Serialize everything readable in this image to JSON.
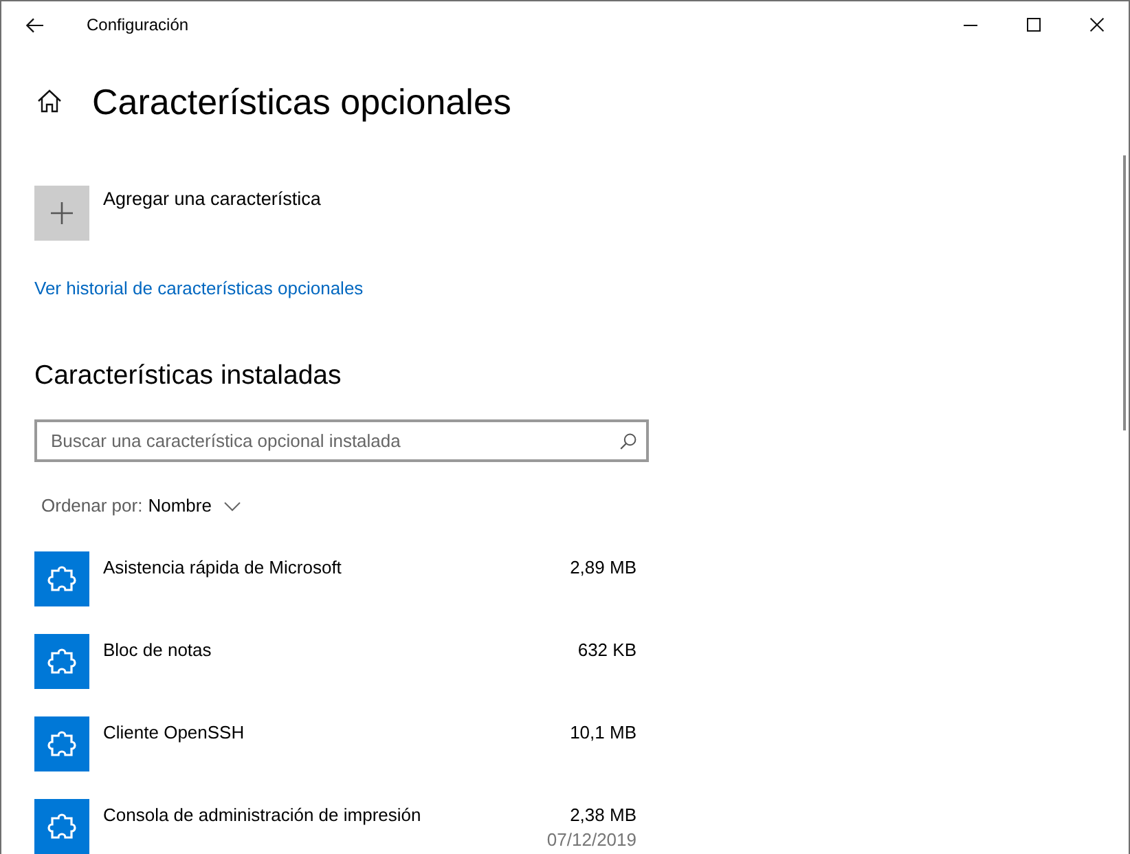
{
  "window": {
    "title": "Configuración"
  },
  "page": {
    "title": "Características opcionales"
  },
  "add_feature": {
    "label": "Agregar una característica"
  },
  "history_link": {
    "label": "Ver historial de características opcionales"
  },
  "installed": {
    "heading": "Características instaladas",
    "search": {
      "placeholder": "Buscar una característica opcional instalada"
    },
    "sort": {
      "label": "Ordenar por:",
      "value": "Nombre"
    },
    "features": [
      {
        "name": "Asistencia rápida de Microsoft",
        "size": "2,89 MB"
      },
      {
        "name": "Bloc de notas",
        "size": "632 KB"
      },
      {
        "name": "Cliente OpenSSH",
        "size": "10,1 MB"
      },
      {
        "name": "Consola de administración de impresión",
        "size": "2,38 MB",
        "date": "07/12/2019"
      }
    ]
  }
}
